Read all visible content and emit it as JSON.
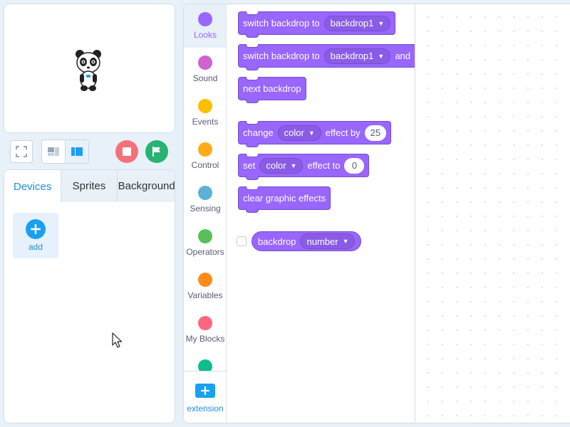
{
  "stage": {
    "sprite_icon": "panda-sprite-icon"
  },
  "stage_controls": {
    "fullscreen_icon": "fullscreen-icon",
    "small_stage_icon": "small-stage-layout-icon",
    "large_stage_icon": "large-stage-layout-icon",
    "stop_icon": "stop-icon",
    "go_icon": "green-flag-icon"
  },
  "tabs": [
    {
      "label": "Devices",
      "active": true
    },
    {
      "label": "Sprites",
      "active": false
    },
    {
      "label": "Background",
      "active": false
    }
  ],
  "devices": {
    "add_label": "add"
  },
  "categories": [
    {
      "label": "Looks",
      "color": "#9966ff",
      "active": true
    },
    {
      "label": "Sound",
      "color": "#cf63cf",
      "active": false
    },
    {
      "label": "Events",
      "color": "#ffbf00",
      "active": false
    },
    {
      "label": "Control",
      "color": "#ffab19",
      "active": false
    },
    {
      "label": "Sensing",
      "color": "#5cb1d6",
      "active": false
    },
    {
      "label": "Operators",
      "color": "#59c059",
      "active": false
    },
    {
      "label": "Variables",
      "color": "#ff8c1a",
      "active": false
    },
    {
      "label": "My Blocks",
      "color": "#ff6680",
      "active": false
    },
    {
      "label": "",
      "color": "#0fbd8c",
      "active": false
    }
  ],
  "extension": {
    "label": "extension"
  },
  "blocks": {
    "switch_backdrop": {
      "text": "switch backdrop to",
      "menu": "backdrop1"
    },
    "switch_backdrop_wait": {
      "text": "switch backdrop to",
      "menu": "backdrop1",
      "suffix": "and"
    },
    "next_backdrop": {
      "text": "next backdrop"
    },
    "change_effect": {
      "text1": "change",
      "menu": "color",
      "text2": "effect by",
      "value": "25"
    },
    "set_effect": {
      "text1": "set",
      "menu": "color",
      "text2": "effect to",
      "value": "0"
    },
    "clear_effects": {
      "text": "clear graphic effects"
    },
    "backdrop_reporter": {
      "text": "backdrop",
      "menu": "number"
    }
  },
  "colors": {
    "looks": "#9966ff",
    "accent": "#1d8fe0"
  }
}
